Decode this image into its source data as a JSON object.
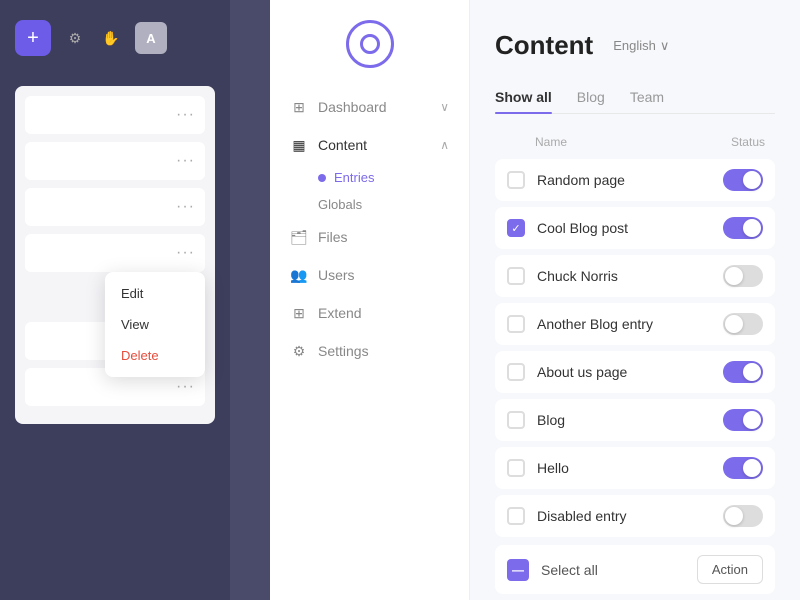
{
  "app": {
    "title": "Content",
    "lang": "English",
    "logo_alt": "App Logo"
  },
  "left_sidebar": {
    "add_label": "+",
    "avatar_label": "A",
    "rows": [
      {
        "id": "row1",
        "dots": "···"
      },
      {
        "id": "row2",
        "dots": "···"
      },
      {
        "id": "row3",
        "dots": "···"
      },
      {
        "id": "row4_menu",
        "dots": "···"
      },
      {
        "id": "row5",
        "dots": "···"
      },
      {
        "id": "row6",
        "dots": "···"
      }
    ],
    "context_menu": {
      "edit": "Edit",
      "view": "View",
      "delete": "Delete"
    }
  },
  "nav": {
    "items": [
      {
        "id": "dashboard",
        "label": "Dashboard",
        "icon": "grid",
        "has_chevron": true
      },
      {
        "id": "content",
        "label": "Content",
        "icon": "file",
        "has_chevron": true,
        "active": true
      },
      {
        "id": "files",
        "label": "Files",
        "icon": "folder"
      },
      {
        "id": "users",
        "label": "Users",
        "icon": "users"
      },
      {
        "id": "extend",
        "label": "Extend",
        "icon": "puzzle"
      },
      {
        "id": "settings",
        "label": "Settings",
        "icon": "settings"
      }
    ],
    "sub_items": [
      {
        "id": "entries",
        "label": "Entries",
        "active": true
      },
      {
        "id": "globals",
        "label": "Globals"
      }
    ]
  },
  "tabs": [
    {
      "id": "show-all",
      "label": "Show all",
      "active": true
    },
    {
      "id": "blog",
      "label": "Blog"
    },
    {
      "id": "team",
      "label": "Team"
    }
  ],
  "table": {
    "col_name": "Name",
    "col_status": "Status",
    "entries": [
      {
        "id": "e1",
        "name": "Random page",
        "checked": false,
        "toggle": "on"
      },
      {
        "id": "e2",
        "name": "Cool Blog post",
        "checked": true,
        "toggle": "on"
      },
      {
        "id": "e3",
        "name": "Chuck Norris",
        "checked": false,
        "toggle": "off"
      },
      {
        "id": "e4",
        "name": "Another Blog entry",
        "checked": false,
        "toggle": "off"
      },
      {
        "id": "e5",
        "name": "About us page",
        "checked": false,
        "toggle": "on"
      },
      {
        "id": "e6",
        "name": "Blog",
        "checked": false,
        "toggle": "on"
      },
      {
        "id": "e7",
        "name": "Hello",
        "checked": false,
        "toggle": "on"
      },
      {
        "id": "e8",
        "name": "Disabled entry",
        "checked": false,
        "toggle": "off"
      }
    ]
  },
  "bottom_bar": {
    "select_all_label": "Select all",
    "action_label": "Action"
  }
}
